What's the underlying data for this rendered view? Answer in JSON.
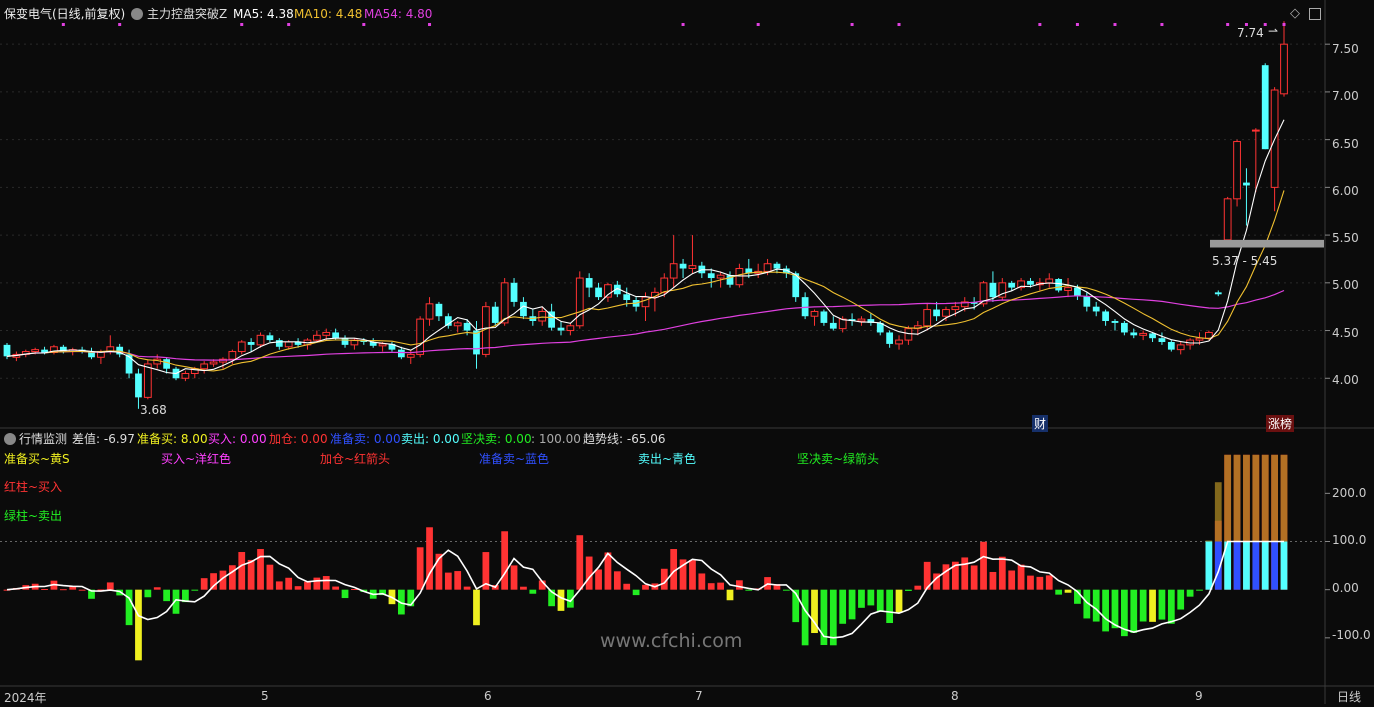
{
  "header": {
    "stock": "保变电气(日线,前复权)",
    "indicator": "主力控盘突破Z",
    "ma5": "MA5: 4.38",
    "ma10": "MA10: 4.48",
    "ma54": "MA54: 4.80"
  },
  "indicator_header": {
    "name": "行情监测",
    "diff": "差值: -6.97",
    "prep_buy": "准备买: 8.00",
    "buy": "买入: 0.00",
    "add": "加仓: 0.00",
    "prep_sell": "准备卖: 0.00",
    "sell": "卖出: 0.00",
    "firm_sell": "坚决卖: 0.00",
    "ref": ": 100.00",
    "trend": "趋势线: -65.06"
  },
  "legend": {
    "l1": "准备买~黄S",
    "l2": "买入~洋红色",
    "l3": "加仓~红箭头",
    "l4": "准备卖~蓝色",
    "l5": "卖出~青色",
    "l6": "坚决卖~绿箭头",
    "l7": "红柱~买入",
    "l8": "绿柱~卖出"
  },
  "annotations": {
    "high": "7.74",
    "low": "3.68",
    "range": "5.37 - 5.45",
    "cai": "财",
    "zhangting": "涨榜",
    "watermark": "www.cfchi.com",
    "period": "日线"
  },
  "colors": {
    "up": "#ff3333",
    "down": "#54ffff",
    "ma5": "#ffffff",
    "ma10": "#f0c030",
    "ma54": "#e040e0",
    "green": "#22ee22",
    "yellow": "#f0f020"
  },
  "chart_data": {
    "type": "candlestick",
    "price_axis": {
      "ticks": [
        "7.50",
        "7.00",
        "6.50",
        "6.00",
        "5.50",
        "5.00",
        "4.50",
        "4.00"
      ],
      "range": [
        3.5,
        7.9
      ]
    },
    "indicator_axis": {
      "ticks": [
        "200.0",
        "100.0",
        "0.00",
        "-100.0"
      ],
      "range": [
        -200,
        290
      ]
    },
    "x_labels": [
      "2024年",
      "5",
      "6",
      "7",
      "8",
      "9"
    ],
    "ohlc": [
      [
        4.35,
        4.37,
        4.2,
        4.23
      ],
      [
        4.22,
        4.28,
        4.18,
        4.25
      ],
      [
        4.25,
        4.3,
        4.22,
        4.28
      ],
      [
        4.28,
        4.32,
        4.25,
        4.3
      ],
      [
        4.3,
        4.33,
        4.25,
        4.27
      ],
      [
        4.27,
        4.35,
        4.25,
        4.33
      ],
      [
        4.33,
        4.35,
        4.26,
        4.28
      ],
      [
        4.28,
        4.32,
        4.24,
        4.3
      ],
      [
        4.3,
        4.33,
        4.26,
        4.28
      ],
      [
        4.28,
        4.32,
        4.2,
        4.22
      ],
      [
        4.22,
        4.3,
        4.15,
        4.28
      ],
      [
        4.28,
        4.45,
        4.25,
        4.33
      ],
      [
        4.33,
        4.36,
        4.22,
        4.25
      ],
      [
        4.25,
        4.3,
        4.0,
        4.05
      ],
      [
        4.05,
        4.1,
        3.68,
        3.8
      ],
      [
        3.8,
        4.2,
        3.78,
        4.15
      ],
      [
        4.15,
        4.25,
        4.1,
        4.2
      ],
      [
        4.2,
        4.22,
        4.05,
        4.1
      ],
      [
        4.1,
        4.12,
        3.98,
        4.0
      ],
      [
        4.0,
        4.08,
        3.97,
        4.05
      ],
      [
        4.05,
        4.12,
        4.0,
        4.1
      ],
      [
        4.1,
        4.18,
        4.05,
        4.15
      ],
      [
        4.15,
        4.2,
        4.12,
        4.17
      ],
      [
        4.17,
        4.22,
        4.1,
        4.2
      ],
      [
        4.2,
        4.3,
        4.15,
        4.28
      ],
      [
        4.28,
        4.4,
        4.25,
        4.38
      ],
      [
        4.38,
        4.42,
        4.28,
        4.35
      ],
      [
        4.35,
        4.48,
        4.32,
        4.45
      ],
      [
        4.45,
        4.48,
        4.38,
        4.4
      ],
      [
        4.4,
        4.42,
        4.3,
        4.33
      ],
      [
        4.33,
        4.4,
        4.3,
        4.38
      ],
      [
        4.38,
        4.42,
        4.32,
        4.35
      ],
      [
        4.35,
        4.42,
        4.3,
        4.4
      ],
      [
        4.4,
        4.5,
        4.38,
        4.45
      ],
      [
        4.45,
        4.52,
        4.4,
        4.48
      ],
      [
        4.48,
        4.52,
        4.4,
        4.42
      ],
      [
        4.42,
        4.45,
        4.32,
        4.35
      ],
      [
        4.35,
        4.42,
        4.3,
        4.4
      ],
      [
        4.4,
        4.42,
        4.35,
        4.38
      ],
      [
        4.38,
        4.42,
        4.32,
        4.34
      ],
      [
        4.34,
        4.38,
        4.28,
        4.36
      ],
      [
        4.36,
        4.38,
        4.28,
        4.3
      ],
      [
        4.3,
        4.33,
        4.2,
        4.22
      ],
      [
        4.22,
        4.3,
        4.15,
        4.25
      ],
      [
        4.25,
        4.65,
        4.22,
        4.62
      ],
      [
        4.62,
        4.85,
        4.55,
        4.78
      ],
      [
        4.78,
        4.8,
        4.6,
        4.65
      ],
      [
        4.65,
        4.68,
        4.52,
        4.55
      ],
      [
        4.55,
        4.6,
        4.48,
        4.58
      ],
      [
        4.58,
        4.62,
        4.45,
        4.5
      ],
      [
        4.5,
        4.6,
        4.1,
        4.25
      ],
      [
        4.25,
        4.8,
        4.22,
        4.75
      ],
      [
        4.75,
        4.8,
        4.55,
        4.58
      ],
      [
        4.58,
        5.05,
        4.55,
        5.0
      ],
      [
        5.0,
        5.05,
        4.75,
        4.8
      ],
      [
        4.8,
        4.85,
        4.62,
        4.65
      ],
      [
        4.65,
        4.72,
        4.55,
        4.6
      ],
      [
        4.6,
        4.75,
        4.55,
        4.7
      ],
      [
        4.7,
        4.78,
        4.5,
        4.53
      ],
      [
        4.53,
        4.6,
        4.45,
        4.5
      ],
      [
        4.5,
        4.58,
        4.45,
        4.55
      ],
      [
        4.55,
        5.12,
        4.52,
        5.05
      ],
      [
        5.05,
        5.1,
        4.85,
        4.95
      ],
      [
        4.95,
        5.0,
        4.82,
        4.85
      ],
      [
        4.85,
        5.0,
        4.8,
        4.98
      ],
      [
        4.98,
        5.02,
        4.85,
        4.88
      ],
      [
        4.88,
        4.95,
        4.75,
        4.82
      ],
      [
        4.82,
        4.85,
        4.7,
        4.75
      ],
      [
        4.75,
        4.9,
        4.6,
        4.85
      ],
      [
        4.85,
        4.95,
        4.7,
        4.9
      ],
      [
        4.9,
        5.1,
        4.85,
        5.05
      ],
      [
        5.05,
        5.5,
        4.95,
        5.2
      ],
      [
        5.2,
        5.25,
        5.05,
        5.15
      ],
      [
        5.15,
        5.5,
        5.1,
        5.18
      ],
      [
        5.18,
        5.22,
        5.05,
        5.1
      ],
      [
        5.1,
        5.15,
        4.95,
        5.05
      ],
      [
        5.05,
        5.12,
        4.95,
        5.08
      ],
      [
        5.08,
        5.12,
        4.95,
        4.98
      ],
      [
        4.98,
        5.2,
        4.95,
        5.15
      ],
      [
        5.15,
        5.25,
        5.05,
        5.1
      ],
      [
        5.1,
        5.2,
        5.05,
        5.12
      ],
      [
        5.12,
        5.25,
        5.08,
        5.2
      ],
      [
        5.2,
        5.22,
        5.1,
        5.15
      ],
      [
        5.15,
        5.18,
        5.05,
        5.1
      ],
      [
        5.1,
        5.12,
        4.8,
        4.85
      ],
      [
        4.85,
        4.9,
        4.62,
        4.65
      ],
      [
        4.65,
        4.72,
        4.55,
        4.7
      ],
      [
        4.7,
        4.72,
        4.55,
        4.58
      ],
      [
        4.58,
        4.65,
        4.5,
        4.52
      ],
      [
        4.52,
        4.65,
        4.48,
        4.62
      ],
      [
        4.62,
        4.68,
        4.55,
        4.6
      ],
      [
        4.6,
        4.65,
        4.55,
        4.62
      ],
      [
        4.62,
        4.68,
        4.55,
        4.58
      ],
      [
        4.58,
        4.6,
        4.45,
        4.48
      ],
      [
        4.48,
        4.5,
        4.32,
        4.36
      ],
      [
        4.36,
        4.45,
        4.3,
        4.4
      ],
      [
        4.4,
        4.55,
        4.35,
        4.52
      ],
      [
        4.52,
        4.6,
        4.45,
        4.55
      ],
      [
        4.55,
        4.78,
        4.5,
        4.72
      ],
      [
        4.72,
        4.8,
        4.6,
        4.65
      ],
      [
        4.65,
        4.75,
        4.6,
        4.72
      ],
      [
        4.72,
        4.8,
        4.65,
        4.75
      ],
      [
        4.75,
        4.85,
        4.7,
        4.8
      ],
      [
        4.8,
        4.85,
        4.72,
        4.78
      ],
      [
        4.78,
        5.02,
        4.75,
        5.0
      ],
      [
        5.0,
        5.12,
        4.8,
        4.85
      ],
      [
        4.85,
        5.05,
        4.82,
        5.0
      ],
      [
        5.0,
        5.02,
        4.92,
        4.95
      ],
      [
        4.95,
        5.05,
        4.92,
        5.02
      ],
      [
        5.02,
        5.05,
        4.95,
        4.98
      ],
      [
        4.98,
        5.05,
        4.92,
        5.0
      ],
      [
        5.0,
        5.1,
        4.95,
        5.04
      ],
      [
        5.04,
        5.05,
        4.9,
        4.92
      ],
      [
        4.92,
        5.05,
        4.85,
        4.95
      ],
      [
        4.95,
        4.98,
        4.82,
        4.86
      ],
      [
        4.86,
        4.9,
        4.7,
        4.75
      ],
      [
        4.75,
        4.8,
        4.65,
        4.7
      ],
      [
        4.7,
        4.72,
        4.55,
        4.6
      ],
      [
        4.6,
        4.62,
        4.5,
        4.58
      ],
      [
        4.58,
        4.6,
        4.45,
        4.48
      ],
      [
        4.48,
        4.52,
        4.42,
        4.45
      ],
      [
        4.45,
        4.5,
        4.4,
        4.47
      ],
      [
        4.47,
        4.48,
        4.38,
        4.42
      ],
      [
        4.42,
        4.48,
        4.35,
        4.38
      ],
      [
        4.38,
        4.4,
        4.28,
        4.3
      ],
      [
        4.3,
        4.38,
        4.25,
        4.35
      ],
      [
        4.35,
        4.42,
        4.3,
        4.4
      ],
      [
        4.4,
        4.48,
        4.35,
        4.42
      ],
      [
        4.42,
        4.5,
        4.4,
        4.48
      ],
      [
        4.9,
        4.92,
        4.86,
        4.88
      ],
      [
        5.45,
        5.9,
        5.37,
        5.88
      ],
      [
        5.88,
        6.5,
        5.8,
        6.48
      ],
      [
        6.05,
        6.2,
        5.6,
        6.02
      ],
      [
        6.6,
        6.62,
        5.95,
        6.6
      ],
      [
        7.28,
        7.3,
        6.4,
        6.4
      ],
      [
        6.0,
        7.05,
        5.75,
        7.02
      ],
      [
        6.98,
        7.74,
        6.95,
        7.5
      ]
    ]
  }
}
